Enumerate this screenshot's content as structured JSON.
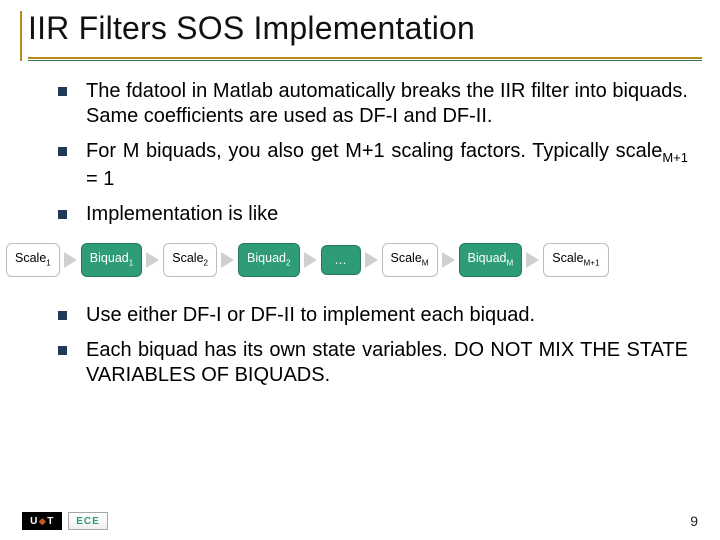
{
  "title": "IIR Filters SOS Implementation",
  "bullets_top": [
    "The fdatool in Matlab automatically breaks the IIR filter into biquads. Same coefficients are used as DF-I and DF-II.",
    "For M biquads, you also get M+1 scaling factors. Typically scale<sub>M+1</sub> = 1",
    "Implementation is like"
  ],
  "chain": {
    "blocks": [
      {
        "kind": "scale",
        "label": "Scale<sub>1</sub>"
      },
      {
        "kind": "biquad",
        "label": "Biquad<sub>1</sub>"
      },
      {
        "kind": "scale",
        "label": "Scale<sub>2</sub>"
      },
      {
        "kind": "biquad",
        "label": "Biquad<sub>2</sub>"
      },
      {
        "kind": "dots",
        "label": "…"
      },
      {
        "kind": "scale",
        "label": "Scale<sub>M</sub>"
      },
      {
        "kind": "biquad",
        "label": "Biquad<sub>M</sub>"
      },
      {
        "kind": "scale",
        "label": "Scale<sub>M+1</sub>"
      }
    ]
  },
  "bullets_bottom": [
    "Use either DF-I or DF-II to implement each biquad.",
    "Each biquad has its own state variables. DO NOT MIX THE STATE VARIABLES OF BIQUADS."
  ],
  "footer": {
    "ut_label_left": "U",
    "ut_label_right": "T",
    "ece_label": "ECE",
    "page_number": "9"
  }
}
